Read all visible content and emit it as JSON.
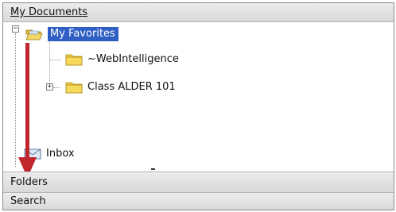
{
  "panels": {
    "my_documents": "My Documents",
    "folders": "Folders",
    "search": "Search"
  },
  "tree": {
    "root": {
      "label": "My Favorites",
      "expander": "−",
      "icon": "open-folder-icon",
      "selected": true
    },
    "children": [
      {
        "label": "~WebIntelligence",
        "icon": "folder-icon"
      },
      {
        "label": "Class ALDER 101",
        "icon": "folder-icon",
        "expander": "+"
      }
    ],
    "inbox": {
      "label": "Inbox",
      "icon": "envelope-icon"
    }
  },
  "colors": {
    "selection": "#2f5ec4",
    "folder_yellow": "#f2cc3c",
    "arrow_red": "#c0262c"
  }
}
